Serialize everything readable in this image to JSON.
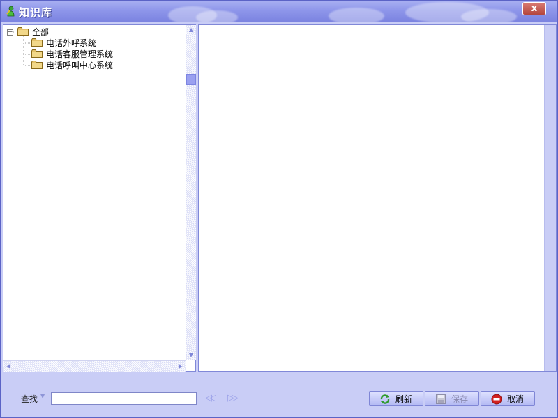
{
  "window": {
    "title": "知识库",
    "close_label": "x",
    "icons": {
      "app": "knowledge-person-icon",
      "close": "close-icon"
    }
  },
  "tree": {
    "root": {
      "label": "全部",
      "expanded": true,
      "expander_glyph": "−"
    },
    "children": [
      {
        "label": "电话外呼系统"
      },
      {
        "label": "电话客服管理系统"
      },
      {
        "label": "电话呼叫中心系统"
      }
    ],
    "icons": {
      "node": "folder-icon"
    }
  },
  "scrollbars": {
    "up": "▲",
    "down": "▼",
    "left": "◀",
    "right": "▶"
  },
  "search": {
    "label": "查找",
    "dropdown_glyph": "▼",
    "value": "",
    "placeholder": "",
    "prev_glyph": "◁◁",
    "next_glyph": "▷▷"
  },
  "buttons": {
    "refresh": {
      "label": "刷新",
      "icon": "refresh-icon",
      "enabled": true
    },
    "save": {
      "label": "保存",
      "icon": "save-icon",
      "enabled": false
    },
    "cancel": {
      "label": "取消",
      "icon": "cancel-icon",
      "enabled": true
    }
  },
  "colors": {
    "title_gradient_top": "#a9b0f2",
    "title_gradient_bottom": "#7a82e0",
    "panel_background": "#c9cdf6",
    "border": "#8088d8",
    "close_button": "#b3453d"
  }
}
